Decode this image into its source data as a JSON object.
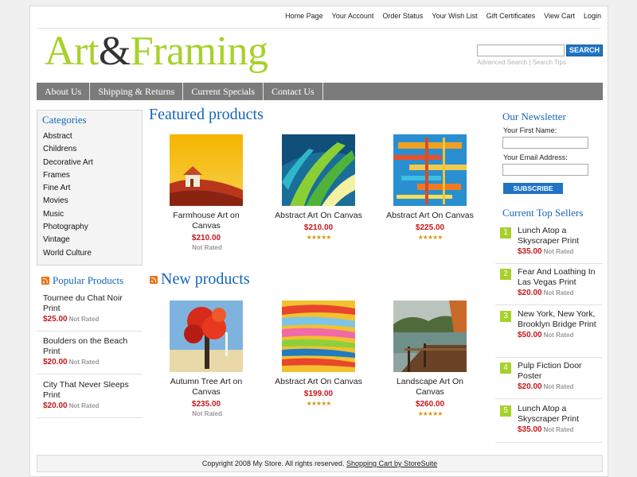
{
  "top_links": [
    "Home Page",
    "Your Account",
    "Order Status",
    "Your Wish List",
    "Gift Certificates",
    "View Cart",
    "Login"
  ],
  "logo": {
    "part1": "Art",
    "amp": "&",
    "part2": "Framing"
  },
  "search": {
    "button_label": "SEARCH",
    "placeholder": "",
    "advanced_link": "Advanced Search",
    "separator": "|",
    "tips_link": "Search Tips"
  },
  "nav": [
    "About Us",
    "Shipping & Returns",
    "Current Specials",
    "Contact Us"
  ],
  "categories": {
    "title": "Categories",
    "items": [
      "Abstract",
      "Childrens",
      "Decorative Art",
      "Frames",
      "Fine Art",
      "Movies",
      "Music",
      "Photography",
      "Vintage",
      "World Culture"
    ]
  },
  "popular": {
    "title": "Popular Products",
    "items": [
      {
        "name": "Tournee du Chat Noir Print",
        "price": "$25.00",
        "rating": "Not Rated"
      },
      {
        "name": "Boulders on the Beach Print",
        "price": "$20.00",
        "rating": "Not Rated"
      },
      {
        "name": "City That Never Sleeps Print",
        "price": "$20.00",
        "rating": "Not Rated"
      }
    ]
  },
  "featured": {
    "title": "Featured products",
    "items": [
      {
        "name": "Farmhouse Art on Canvas",
        "price": "$210.00",
        "rating": "Not Rated"
      },
      {
        "name": "Abstract Art On Canvas",
        "price": "$210.00",
        "rating": "★★★★★"
      },
      {
        "name": "Abstract Art On Canvas",
        "price": "$225.00",
        "rating": "★★★★★"
      }
    ]
  },
  "new_products": {
    "title": "New products",
    "items": [
      {
        "name": "Autumn Tree Art on Canvas",
        "price": "$235.00",
        "rating": "Not Rated"
      },
      {
        "name": "Abstract Art On Canvas",
        "price": "$199.00",
        "rating": "★★★★★"
      },
      {
        "name": "Landscape Art On Canvas",
        "price": "$260.00",
        "rating": "★★★★★"
      }
    ]
  },
  "newsletter": {
    "title": "Our Newsletter",
    "first_name_label": "Your First Name:",
    "email_label": "Your Email Address:",
    "subscribe_label": "SUBSCRIBE"
  },
  "top_sellers": {
    "title": "Current Top Sellers",
    "items": [
      {
        "rank": "1",
        "name": "Lunch Atop a Skyscraper Print",
        "price": "$35.00",
        "rating": "Not Rated"
      },
      {
        "rank": "2",
        "name": "Fear And Loathing In Las Vegas Print",
        "price": "$20.00",
        "rating": "Not Rated"
      },
      {
        "rank": "3",
        "name": "New York, New York, Brooklyn Bridge Print",
        "price": "$50.00",
        "rating": "Not Rated"
      },
      {
        "rank": "4",
        "name": "Pulp Fiction Door Poster",
        "price": "$20.00",
        "rating": "Not Rated"
      },
      {
        "rank": "5",
        "name": "Lunch Atop a Skyscraper Print",
        "price": "$35.00",
        "rating": "Not Rated"
      }
    ]
  },
  "footer": {
    "copyright": "Copyright 2008 My Store. All rights reserved.",
    "link": "Shopping Cart by StoreSuite"
  },
  "colors": {
    "accent_green": "#a7d12a",
    "link_blue": "#1565b8",
    "price_red": "#c8171c",
    "nav_gray": "#7b7b7b",
    "button_blue": "#1f74c6"
  }
}
